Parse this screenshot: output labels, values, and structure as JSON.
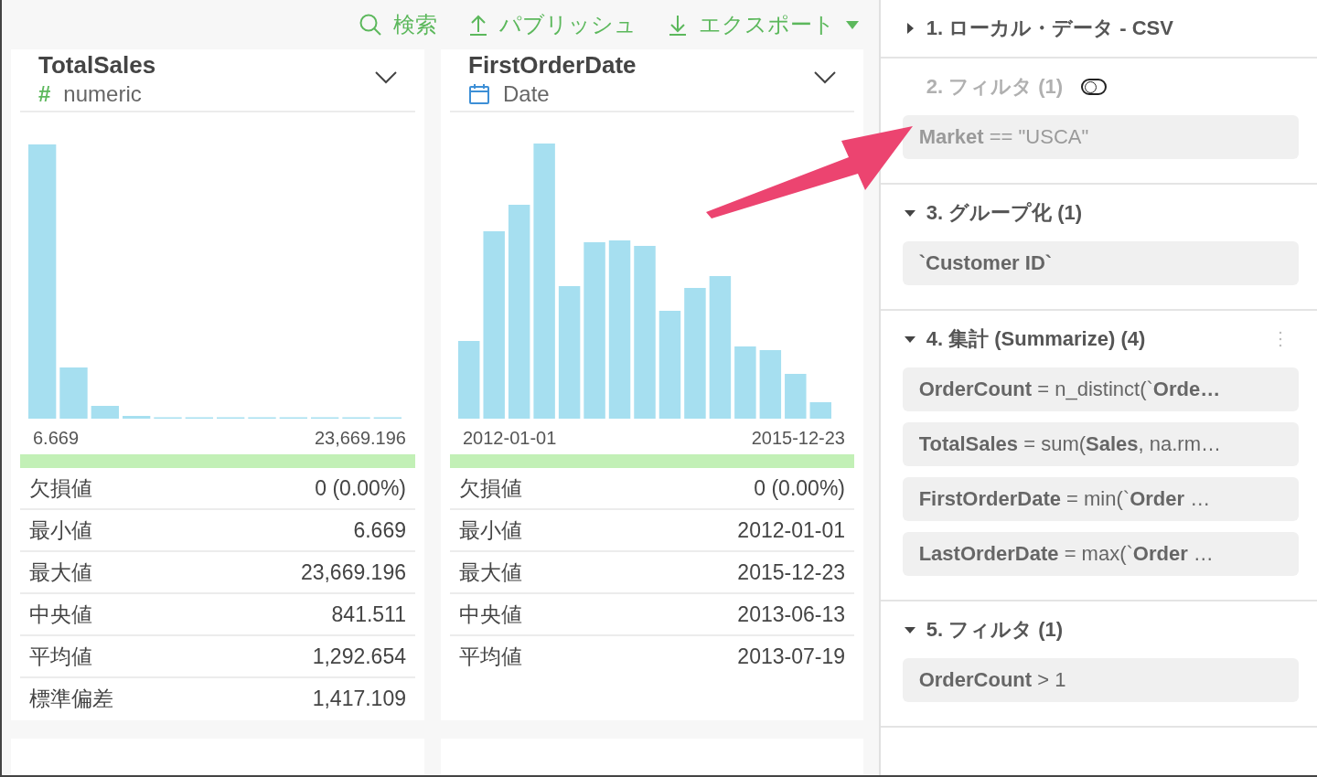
{
  "toolbar": [
    {
      "kind": "search",
      "label": "検索"
    },
    {
      "kind": "publish",
      "label": "パブリッシュ"
    },
    {
      "kind": "export",
      "label": "エクスポート"
    }
  ],
  "columns": [
    {
      "name": "TotalSales",
      "kind": "numeric",
      "type_glyph": "#",
      "type": "numeric",
      "range_min": "6.669",
      "range_max": "23,669.196",
      "stats": [
        {
          "label": "欠損値",
          "value": "0 (0.00%)"
        },
        {
          "label": "最小値",
          "value": "6.669"
        },
        {
          "label": "最大値",
          "value": "23,669.196"
        },
        {
          "label": "中央値",
          "value": "841.511"
        },
        {
          "label": "平均値",
          "value": "1,292.654"
        },
        {
          "label": "標準偏差",
          "value": "1,417.109"
        }
      ]
    },
    {
      "name": "FirstOrderDate",
      "kind": "date",
      "type": "Date",
      "range_min": "2012-01-01",
      "range_max": "2015-12-23",
      "stats": [
        {
          "label": "欠損値",
          "value": "0 (0.00%)"
        },
        {
          "label": "最小値",
          "value": "2012-01-01"
        },
        {
          "label": "最大値",
          "value": "2015-12-23"
        },
        {
          "label": "中央値",
          "value": "2013-06-13"
        },
        {
          "label": "平均値",
          "value": "2013-07-19"
        }
      ]
    }
  ],
  "steps": [
    {
      "title": "1. ローカル・データ - CSV",
      "expanded": false,
      "disabled": false
    },
    {
      "title": "2. フィルタ (1)",
      "disabled": true,
      "toggle": {
        "on": false
      },
      "items": [
        "**Market** == \"USCA\""
      ]
    },
    {
      "title": "3. グループ化 (1)",
      "expanded": true,
      "disabled": false,
      "items": [
        "**`Customer ID`**"
      ]
    },
    {
      "title": "4. 集計 (Summarize) (4)",
      "expanded": true,
      "disabled": false,
      "menu": true,
      "items": [
        "**OrderCount** = n_distinct(`**Orde…**",
        "**TotalSales** = sum(**Sales**, na.rm…",
        "**FirstOrderDate** = min(`**Order** …",
        "**LastOrderDate** = max(`**Order** …"
      ]
    },
    {
      "title": "5. フィルタ (1)",
      "expanded": true,
      "disabled": false,
      "items": [
        "**OrderCount** > 1"
      ]
    }
  ]
}
